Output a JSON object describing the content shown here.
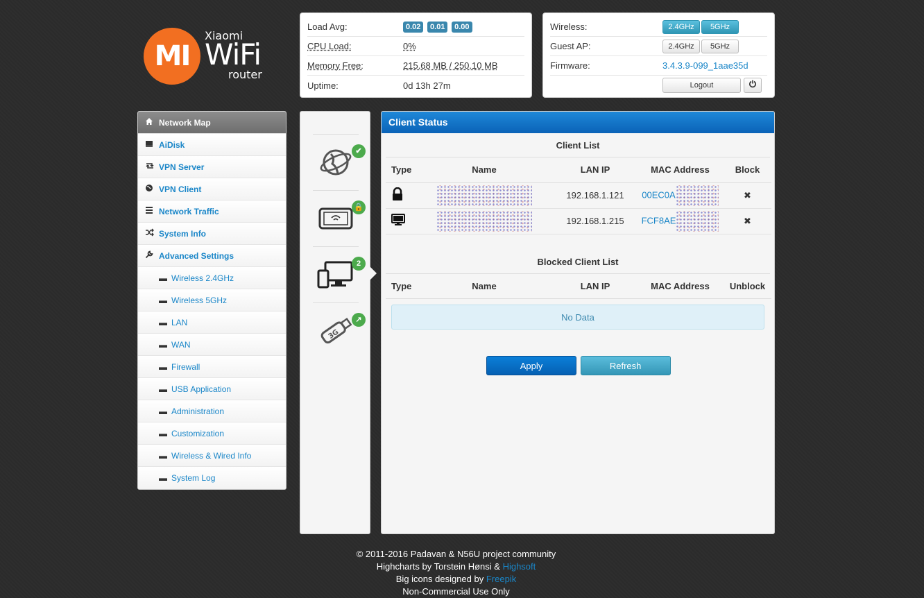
{
  "logo": {
    "mi": "MI",
    "brand": "Xiaomi",
    "wifi": "WiFi",
    "router": "router"
  },
  "status": {
    "load_avg_label": "Load Avg:",
    "load_avg": [
      "0.02",
      "0.01",
      "0.00"
    ],
    "cpu_label": "CPU Load:",
    "cpu_value": "0%",
    "mem_label": "Memory Free:",
    "mem_value": "215.68 MB / 250.10 MB",
    "uptime_label": "Uptime:",
    "uptime_value": "0d 13h 27m"
  },
  "wireless": {
    "wireless_label": "Wireless:",
    "guest_label": "Guest AP:",
    "band_24": "2.4GHz",
    "band_5": "5GHz",
    "firmware_label": "Firmware:",
    "firmware_value": "3.4.3.9-099_1aae35d",
    "logout": "Logout",
    "power_icon": "power-icon"
  },
  "sidebar": {
    "items": [
      {
        "label": "Network Map",
        "icon": "home-icon"
      },
      {
        "label": "AiDisk",
        "icon": "disk-icon"
      },
      {
        "label": "VPN Server",
        "icon": "retweet-icon"
      },
      {
        "label": "VPN Client",
        "icon": "globe-icon"
      },
      {
        "label": "Network Traffic",
        "icon": "list-icon"
      },
      {
        "label": "System Info",
        "icon": "random-icon"
      },
      {
        "label": "Advanced Settings",
        "icon": "wrench-icon"
      }
    ],
    "subitems": [
      "Wireless 2.4GHz",
      "Wireless 5GHz",
      "LAN",
      "WAN",
      "Firewall",
      "USB Application",
      "Administration",
      "Customization",
      "Wireless & Wired Info",
      "System Log"
    ]
  },
  "icon_column": {
    "client_count": "2"
  },
  "main": {
    "title": "Client Status",
    "client_list_title": "Client List",
    "headers": [
      "Type",
      "Name",
      "LAN IP",
      "MAC Address",
      "Block"
    ],
    "clients": [
      {
        "type_icon": "lock-icon",
        "ip": "192.168.1.121",
        "mac": "00EC0A"
      },
      {
        "type_icon": "desktop-icon",
        "ip": "192.168.1.215",
        "mac": "FCF8AE"
      }
    ],
    "block_symbol": "✖",
    "blocked_title": "Blocked Client List",
    "blocked_headers": [
      "Type",
      "Name",
      "LAN IP",
      "MAC Address",
      "Unblock"
    ],
    "no_data": "No Data",
    "apply": "Apply",
    "refresh": "Refresh"
  },
  "footer": {
    "line1": "© 2011-2016 Padavan & N56U project community",
    "line2_prefix": "Highcharts by Torstein Hønsi & ",
    "line2_link": "Highsoft",
    "line3_prefix": "Big icons designed by ",
    "line3_link": "Freepik",
    "line4": "Non-Commercial Use Only"
  },
  "colors": {
    "accent": "#1a86c8",
    "header_blue": "#0a62b7",
    "badge": "#3a87ad",
    "brand_orange": "#f26f21"
  }
}
